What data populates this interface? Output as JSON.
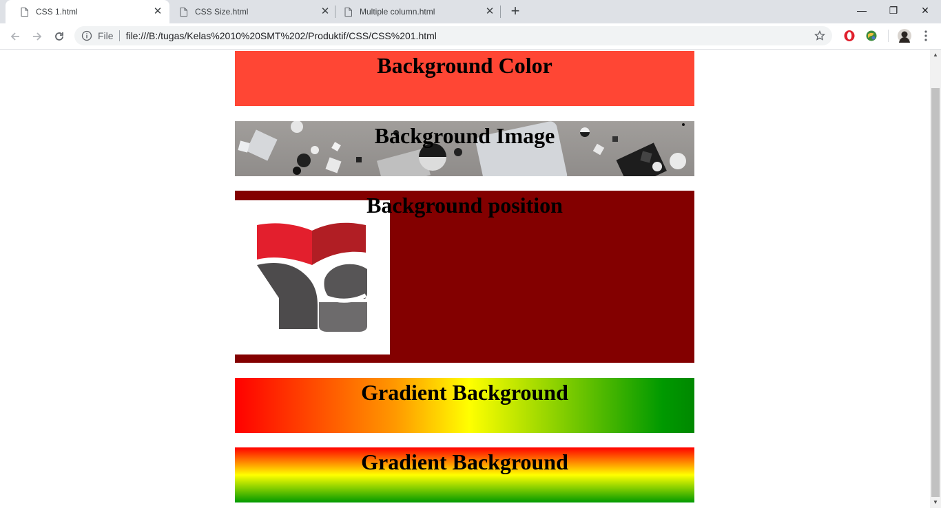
{
  "tabs": [
    {
      "title": "CSS 1.html",
      "close": "✕"
    },
    {
      "title": "CSS Size.html",
      "close": "✕"
    },
    {
      "title": "Multiple column.html",
      "close": "✕"
    }
  ],
  "new_tab": "+",
  "window_controls": {
    "minimize": "—",
    "restore": "❐",
    "close": "✕"
  },
  "toolbar": {
    "scheme_label": "File",
    "url": "file:///B:/tugas/Kelas%2010%20SMT%202/Produktif/CSS/CSS%201.html"
  },
  "page": {
    "sections": [
      {
        "heading": "Background Color",
        "color": "#ff4634"
      },
      {
        "heading": "Background Image"
      },
      {
        "heading": "Background position",
        "color": "#830000"
      },
      {
        "heading": "Gradient Background",
        "gradient": [
          "#ff0000",
          "#ffff00",
          "#008800"
        ]
      },
      {
        "heading": "Gradient Background",
        "gradient": [
          "#ff0000",
          "#ffff00",
          "#009900"
        ]
      }
    ]
  },
  "colors": {
    "tabstrip": "#dee1e6",
    "omnibox": "#f1f3f4",
    "logo_red": "#e31f2d",
    "logo_dark_red": "#b11e24",
    "logo_gray": "#4d4b4c"
  },
  "icons": [
    "page-icon",
    "back-icon",
    "forward-icon",
    "reload-icon",
    "info-icon",
    "star-icon",
    "opera-icon",
    "extension-icon",
    "profile-avatar-icon",
    "menu-icon"
  ]
}
